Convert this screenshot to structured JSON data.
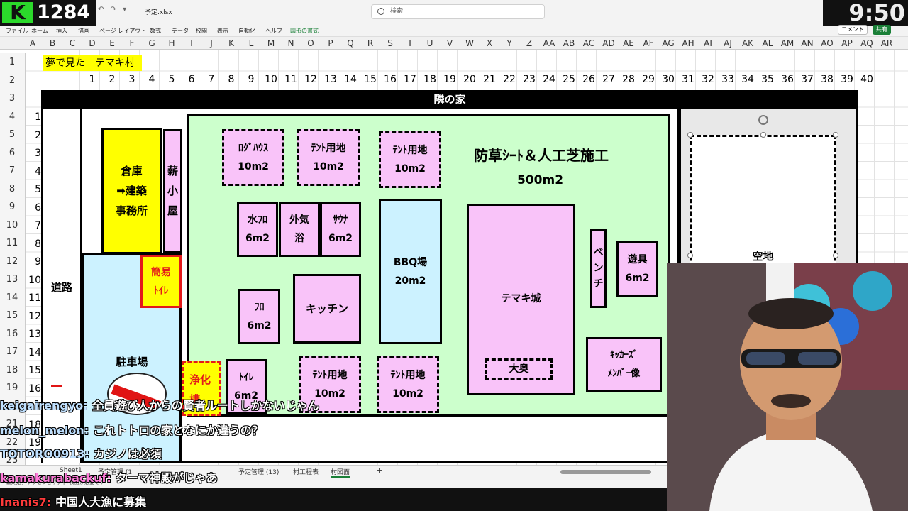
{
  "stream": {
    "counter": "1284",
    "clock": "9:50",
    "logo_letter": "K"
  },
  "excel": {
    "filename": "予定.xlsx",
    "search_placeholder": "検索",
    "ribbon_tabs": [
      "ファイル",
      "ホーム",
      "挿入",
      "描画",
      "ページ レイアウト",
      "数式",
      "データ",
      "校閲",
      "表示",
      "自動化",
      "ヘルプ",
      "図形の書式"
    ],
    "comment_btn": "コメント",
    "share_btn": "共有",
    "columns": [
      "A",
      "B",
      "C",
      "D",
      "E",
      "F",
      "G",
      "H",
      "I",
      "J",
      "K",
      "L",
      "M",
      "N",
      "O",
      "P",
      "Q",
      "R",
      "S",
      "T",
      "U",
      "V",
      "W",
      "X",
      "Y",
      "Z",
      "AA",
      "AB",
      "AC",
      "AD",
      "AE",
      "AF",
      "AG",
      "AH",
      "AI",
      "AJ",
      "AK",
      "AL",
      "AM",
      "AN",
      "AO",
      "AP",
      "AQ",
      "AR"
    ],
    "rows": [
      "1",
      "2",
      "3",
      "4",
      "5",
      "6",
      "7",
      "8",
      "9",
      "10",
      "11",
      "12",
      "13",
      "14",
      "15",
      "16",
      "17",
      "18",
      "19",
      "20",
      "21",
      "22",
      "23"
    ],
    "sheet_tabs": [
      "Sheet1",
      "予定管理 (1",
      "予定管理 (13)",
      "村工程表",
      "村図面"
    ],
    "add_sheet": "+",
    "status": "編集完了 アクセシビリティ: 検討が必要です"
  },
  "sheet": {
    "title": "夢で見た　テマキ村",
    "number_row": [
      "1",
      "2",
      "3",
      "4",
      "5",
      "6",
      "7",
      "8",
      "9",
      "10",
      "11",
      "12",
      "13",
      "14",
      "15",
      "16",
      "17",
      "18",
      "19",
      "20",
      "21",
      "22",
      "23",
      "24",
      "25",
      "26",
      "27",
      "28",
      "29",
      "30",
      "31",
      "32",
      "33",
      "34",
      "35",
      "36",
      "37",
      "38",
      "39",
      "40"
    ],
    "number_col": [
      "1",
      "2",
      "3",
      "4",
      "5",
      "6",
      "7",
      "8",
      "9",
      "10",
      "11",
      "12",
      "13",
      "14",
      "15",
      "16",
      "17",
      "18",
      "19"
    ]
  },
  "map": {
    "neighbor": "隣の家",
    "road": "道路",
    "parking": "駐車場",
    "warehouse": [
      "倉庫",
      "➡建築",
      "事務所"
    ],
    "firewood": [
      "薪",
      "小",
      "屋"
    ],
    "toilet_simple": [
      "簡易",
      "ﾄｲﾚ"
    ],
    "septic": [
      "浄化",
      "槽"
    ],
    "lawn_label": "防草ｼｰﾄ＆人工芝施工",
    "lawn_area": "500m2",
    "log_house": [
      "ﾛｸﾞﾊｳｽ",
      "10m2"
    ],
    "tent1": [
      "ﾃﾝﾄ用地",
      "10m2"
    ],
    "tent2": [
      "ﾃﾝﾄ用地",
      "10m2"
    ],
    "tent3": [
      "ﾃﾝﾄ用地",
      "10m2"
    ],
    "tent4": [
      "ﾃﾝﾄ用地",
      "10m2"
    ],
    "cold_bath": [
      "水ﾌﾛ",
      "6m2"
    ],
    "outdoor_bath": [
      "外気",
      "浴"
    ],
    "sauna": [
      "ｻｳﾅ",
      "6m2"
    ],
    "bath": [
      "ﾌﾛ",
      "6m2"
    ],
    "kitchen": "キッチン",
    "toilet": [
      "ﾄｲﾚ",
      "6m2"
    ],
    "bbq": [
      "BBQ場",
      "20m2"
    ],
    "castle": "テマキ城",
    "ooku": "大奥",
    "bench": [
      "ベ",
      "ン",
      "チ"
    ],
    "playground": [
      "遊具",
      "6m2"
    ],
    "statue": [
      "ｷｯｶｰｽﾞ",
      "ﾒﾝﾊﾞｰ像"
    ],
    "vacant": "空地"
  },
  "chat": [
    {
      "user": "keigairengyo:",
      "msg": "全員遊び人からの賢者ルートしかないじゃん",
      "color": "#bfe0ff"
    },
    {
      "user": "melon_melon:",
      "msg": "これトトロの家となにか違うの？",
      "color": "#bfe0ff"
    },
    {
      "user": "TOTORO0913:",
      "msg": "カジノは必須",
      "color": "#bfe0ff"
    },
    {
      "user": "kamakurabackuf:",
      "msg": "ターマ神殿がじゃあ",
      "color": "#ff7ad9"
    },
    {
      "user": "Inanis7:",
      "msg": "中国人大漁に募集",
      "color": "#ff3b3b"
    }
  ]
}
